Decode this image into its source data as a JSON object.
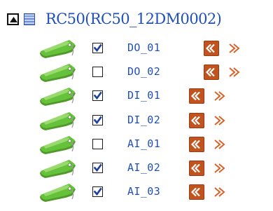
{
  "tree": {
    "root": {
      "label": "RC50(RC50_12DM0002)",
      "expanded": true,
      "collapse_icon": "collapse-minus-icon",
      "folder_icon": "folder-icon"
    },
    "items": [
      {
        "label": "DO_01",
        "checked": true
      },
      {
        "label": "DO_02",
        "checked": false
      },
      {
        "label": "DI_01",
        "checked": true
      },
      {
        "label": "DI_02",
        "checked": true
      },
      {
        "label": "AI_01",
        "checked": false
      },
      {
        "label": "AI_02",
        "checked": true
      },
      {
        "label": "AI_03",
        "checked": true
      }
    ],
    "item_icons": {
      "tag": "tag-icon",
      "prev": "chevron-left-double-icon",
      "next": "chevron-right-double-icon"
    }
  },
  "colors": {
    "link_blue": "#1f4fb8",
    "tag_green": "#5cb82e",
    "button_orange": "#c1541e",
    "next_arrow": "#d8632a"
  }
}
